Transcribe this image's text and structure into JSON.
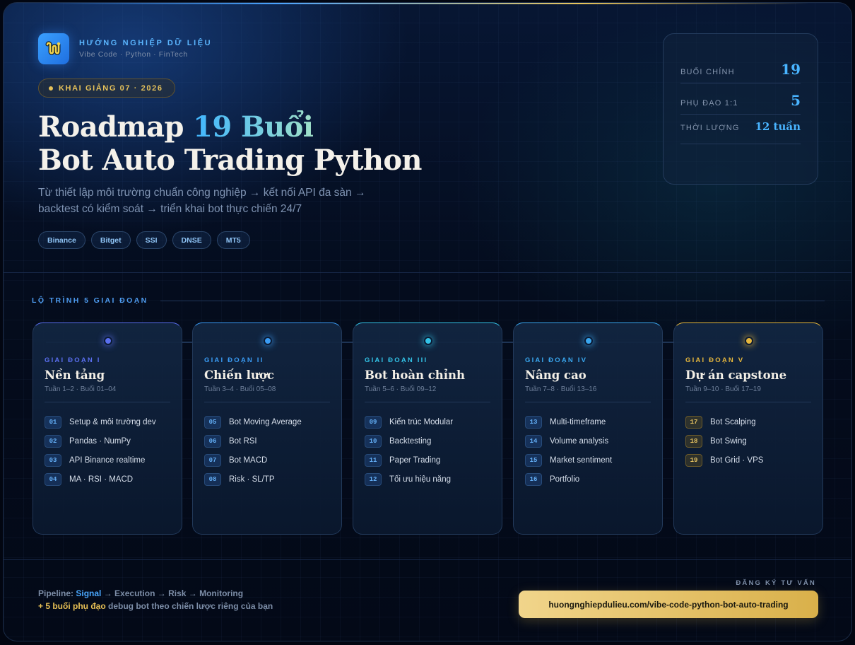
{
  "brand": {
    "name": "HƯỚNG NGHIỆP DỮ LIỆU",
    "subtitle": "Vibe Code · Python · FinTech",
    "logo_icon": "snake-logo-icon"
  },
  "launch_badge": "KHAI GIẢNG 07 · 2026",
  "hero": {
    "title_line1_prefix": "Roadmap ",
    "title_line1_highlight": "19 Buổi",
    "title_line2": "Bot Auto Trading Python",
    "subtitle": "Từ thiết lập môi trường chuẩn công nghiệp → kết nối API đa sàn → backtest có kiểm soát → triển khai bot thực chiến 24/7",
    "exchanges": [
      "Binance",
      "Bitget",
      "SSI",
      "DNSE",
      "MT5"
    ]
  },
  "stats": [
    {
      "label": "BUỔI CHÍNH",
      "value": "19"
    },
    {
      "label": "PHỤ ĐẠO 1:1",
      "value": "5"
    },
    {
      "label": "THỜI LƯỢNG",
      "value": "12 tuần"
    }
  ],
  "roadmap": {
    "section_label": "LỘ TRÌNH 5 GIAI ĐOẠN",
    "phases": [
      {
        "label": "GIAI ĐOẠN I",
        "title": "Nền tảng",
        "weeks": "Tuần 1–2 · Buổi 01–04",
        "accent": "#5a6ff0",
        "items": [
          {
            "num": "01",
            "text": "Setup & môi trường dev"
          },
          {
            "num": "02",
            "text": "Pandas · NumPy"
          },
          {
            "num": "03",
            "text": "API Binance realtime"
          },
          {
            "num": "04",
            "text": "MA · RSI · MACD"
          }
        ]
      },
      {
        "label": "GIAI ĐOẠN II",
        "title": "Chiến lược",
        "weeks": "Tuần 3–4 · Buổi 05–08",
        "accent": "#3a9cf5",
        "items": [
          {
            "num": "05",
            "text": "Bot Moving Average"
          },
          {
            "num": "06",
            "text": "Bot RSI"
          },
          {
            "num": "07",
            "text": "Bot MACD"
          },
          {
            "num": "08",
            "text": "Risk · SL/TP"
          }
        ]
      },
      {
        "label": "GIAI ĐOẠN III",
        "title": "Bot hoàn chỉnh",
        "weeks": "Tuần 5–6 · Buổi 09–12",
        "accent": "#33c4e8",
        "items": [
          {
            "num": "09",
            "text": "Kiến trúc Modular"
          },
          {
            "num": "10",
            "text": "Backtesting"
          },
          {
            "num": "11",
            "text": "Paper Trading"
          },
          {
            "num": "12",
            "text": "Tối ưu hiệu năng"
          }
        ]
      },
      {
        "label": "GIAI ĐOẠN IV",
        "title": "Nâng cao",
        "weeks": "Tuần 7–8 · Buổi 13–16",
        "accent": "#3aa8f0",
        "items": [
          {
            "num": "13",
            "text": "Multi-timeframe"
          },
          {
            "num": "14",
            "text": "Volume analysis"
          },
          {
            "num": "15",
            "text": "Market sentiment"
          },
          {
            "num": "16",
            "text": "Portfolio"
          }
        ]
      },
      {
        "label": "GIAI ĐOẠN V",
        "title": "Dự án capstone",
        "weeks": "Tuần 9–10 · Buổi 17–19",
        "accent": "#e6b73c",
        "items": [
          {
            "num": "17",
            "text": "Bot Scalping"
          },
          {
            "num": "18",
            "text": "Bot Swing"
          },
          {
            "num": "19",
            "text": "Bot Grid · VPS"
          }
        ]
      }
    ]
  },
  "footer": {
    "pipeline_label": "Pipeline:",
    "pipeline_first": "Signal",
    "pipeline_rest": "→ Execution → Risk → Monitoring",
    "tutoring_highlight": "+ 5 buổi phụ đạo",
    "tutoring_rest": "debug bot theo chiến lược riêng của bạn",
    "cta_label": "ĐĂNG KÝ TƯ VẤN",
    "cta_url": "huongnghiepdulieu.com/vibe-code-python-bot-auto-trading"
  }
}
